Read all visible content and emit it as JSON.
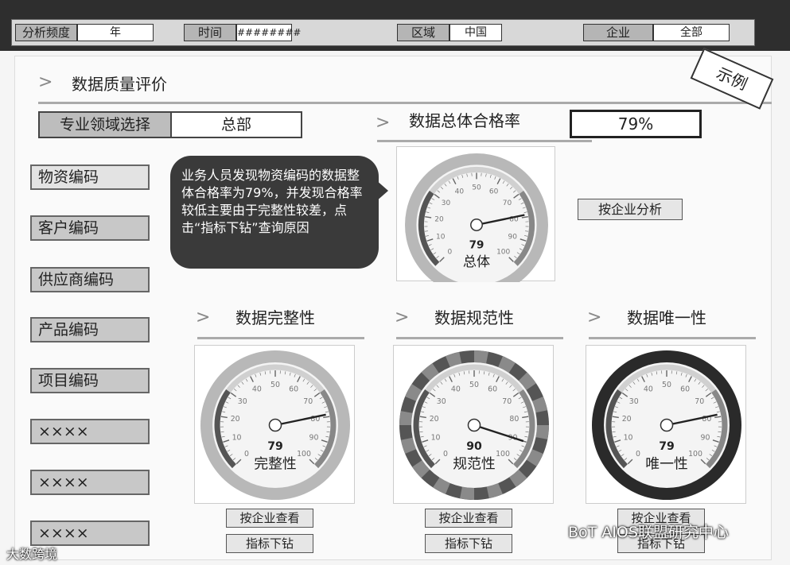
{
  "filters": {
    "period_label": "分析频度",
    "period_value": "年",
    "time_label": "时间",
    "time_value": "########",
    "region_label": "区域",
    "region_value": "中国",
    "company_label": "企业",
    "company_value": "全部"
  },
  "page_title": "数据质量评价",
  "sample_stamp": "示例",
  "domain_select": {
    "label": "专业领域选择",
    "value": "总部"
  },
  "overall": {
    "title": "数据总体合格率",
    "value_text": "79%",
    "gauge_value": 79,
    "gauge_label": "总体",
    "analyze_button": "按企业分析"
  },
  "nav_items": [
    "物资编码",
    "客户编码",
    "供应商编码",
    "产品编码",
    "项目编码",
    "××××",
    "××××",
    "××××"
  ],
  "tooltip": "业务人员发现物资编码的数据整体合格率为79%，并发现合格率较低主要由于完整性较差，点击“指标下钻”查询原因",
  "sections": [
    {
      "title": "数据完整性",
      "gauge_value": 79,
      "gauge_label": "完整性",
      "view_button": "按企业查看",
      "drill_button": "指标下钻"
    },
    {
      "title": "数据规范性",
      "gauge_value": 90,
      "gauge_label": "规范性",
      "view_button": "按企业查看",
      "drill_button": "指标下钻"
    },
    {
      "title": "数据唯一性",
      "gauge_value": 79,
      "gauge_label": "唯一性",
      "view_button": "按企业查看",
      "drill_button": "指标下钻"
    }
  ],
  "gauge_ticks": [
    "0",
    "10",
    "20",
    "30",
    "40",
    "50",
    "60",
    "70",
    "80",
    "90",
    "100"
  ],
  "watermarks": {
    "left": "大数跨境",
    "right": "BoT AIOS联盟研究中心"
  },
  "colors": {
    "dark": "#2e2e2e",
    "panel": "#fafafa",
    "button": "#c8c8c8"
  }
}
